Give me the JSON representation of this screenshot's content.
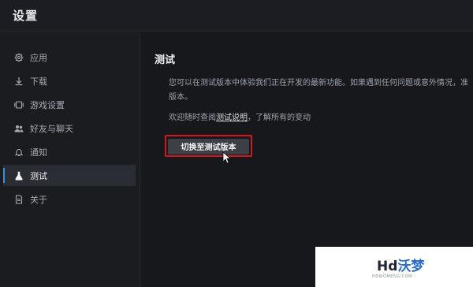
{
  "app": {
    "title": "设置"
  },
  "sidebar": {
    "items": [
      {
        "label": "应用",
        "icon": "gear-icon",
        "active": false
      },
      {
        "label": "下载",
        "icon": "download-icon",
        "active": false
      },
      {
        "label": "游戏设置",
        "icon": "game-settings-icon",
        "active": false
      },
      {
        "label": "好友与聊天",
        "icon": "friends-icon",
        "active": false
      },
      {
        "label": "通知",
        "icon": "bell-icon",
        "active": false
      },
      {
        "label": "测试",
        "icon": "flask-icon",
        "active": true
      },
      {
        "label": "关于",
        "icon": "document-icon",
        "active": false
      }
    ]
  },
  "main": {
    "title": "测试",
    "description": "您可以在测试版本中体验我们正在开发的最新功能。如果遇到任何问题或意外情况，准版本。",
    "help_prefix": "欢迎随时查阅",
    "help_link": "测试说明",
    "help_suffix": "，了解所有的变动",
    "switch_button": "切换至测试版本"
  },
  "watermark": {
    "logo_main": "Hd",
    "logo_accent": "沃梦",
    "sub": "HDWOMENG.COM"
  },
  "colors": {
    "accent": "#3a8dde",
    "highlight_border": "#d6161c",
    "background": "#16181c"
  }
}
